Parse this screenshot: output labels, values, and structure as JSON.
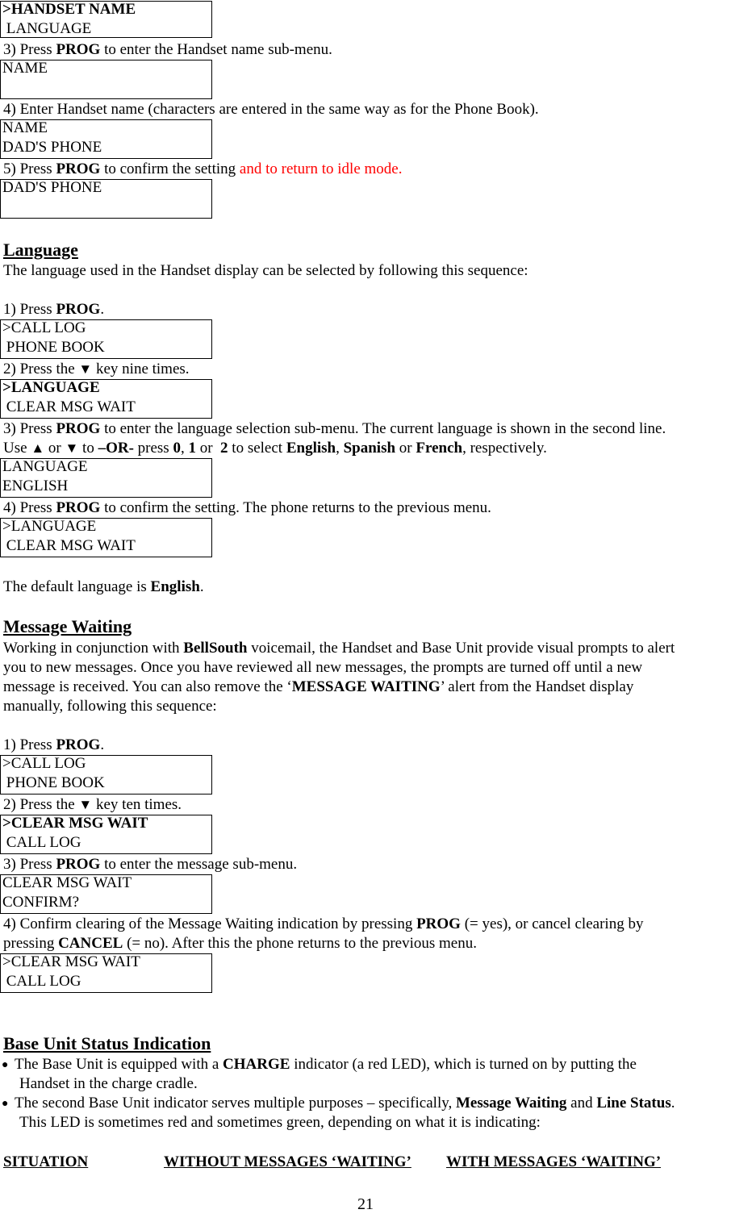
{
  "page_number": "21",
  "colors": {
    "highlight_red": "#ff0000",
    "text": "#000000"
  },
  "handset_name": {
    "lcd1": {
      "line1": ">HANDSET NAME",
      "line2": " LANGUAGE"
    },
    "step3": {
      "pre": "3) Press ",
      "key": "PROG",
      "post": " to enter the Handset name sub-menu."
    },
    "lcd2": {
      "line1": "NAME",
      "line2": ""
    },
    "step4": "4) Enter Handset name (characters are entered in the same way as for the Phone Book).",
    "lcd3": {
      "line1": "NAME",
      "line2": "DAD'S PHONE"
    },
    "step5": {
      "pre": "5) Press ",
      "key": "PROG",
      "mid": " to confirm the setting ",
      "red": "and to return to idle mode."
    },
    "lcd4": {
      "line1": "DAD'S PHONE",
      "line2": ""
    }
  },
  "language": {
    "title": "Language",
    "intro": "The language used in the Handset display can be selected by following this sequence:",
    "step1": {
      "pre": "1) Press ",
      "key": "PROG",
      "post": "."
    },
    "lcd1": {
      "line1": ">CALL LOG",
      "line2": " PHONE BOOK"
    },
    "step2": {
      "pre": "2) Press the ",
      "arrow": "▼",
      "post": " key nine times."
    },
    "lcd2": {
      "line1": ">LANGUAGE",
      "line2": " CLEAR MSG WAIT"
    },
    "step3a": {
      "pre": "3) Press ",
      "key": "PROG",
      "post": " to enter the language selection sub-menu. The current language is shown in the second line."
    },
    "step3b": {
      "t1": "Use ",
      "up": "▲",
      "t2": " or ",
      "down": "▼",
      "t3": " to ",
      "or": "–OR-",
      "t4": " press ",
      "k0": "0",
      "t5": ", ",
      "k1": "1",
      "t6": " or  ",
      "k2": "2",
      "t7": " to select ",
      "en": "English",
      "t8": ", ",
      "es": "Spanish",
      "t9": " or ",
      "fr": "French",
      "t10": ", respectively."
    },
    "lcd3": {
      "line1": "LANGUAGE",
      "line2": "ENGLISH"
    },
    "step4": {
      "pre": "4) Press ",
      "key": "PROG",
      "post": " to confirm the setting. The phone returns to the previous menu."
    },
    "lcd4": {
      "line1": ">LANGUAGE",
      "line2": " CLEAR MSG WAIT"
    },
    "default": {
      "pre": "The default language is ",
      "value": "English",
      "post": "."
    }
  },
  "message_waiting": {
    "title": "Message Waiting",
    "para": {
      "l1pre": "Working in conjunction with ",
      "brand": "BellSouth",
      "l1post": " voicemail, the Handset and Base Unit provide visual prompts to alert",
      "l2": "you to new messages.  Once you have reviewed all new messages, the prompts are turned off until a new",
      "l3pre": "message is received.  You can also remove the ‘",
      "alert": "MESSAGE WAITING",
      "l3post": "’ alert from the Handset display",
      "l4": "manually, following this sequence:"
    },
    "step1": {
      "pre": "1) Press ",
      "key": "PROG",
      "post": "."
    },
    "lcd1": {
      "line1": ">CALL LOG",
      "line2": " PHONE BOOK"
    },
    "step2": {
      "pre": "2) Press the ",
      "arrow": "▼",
      "post": " key ten times."
    },
    "lcd2": {
      "line1": ">CLEAR MSG WAIT",
      "line2": " CALL LOG"
    },
    "step3": {
      "pre": "3) Press ",
      "key": "PROG",
      "post": " to enter the message sub-menu."
    },
    "lcd3": {
      "line1": "CLEAR MSG WAIT",
      "line2": "CONFIRM?"
    },
    "step4": {
      "l1pre": "4) Confirm clearing of the Message Waiting indication by pressing ",
      "key1": "PROG",
      "l1post": " (= yes), or cancel clearing by",
      "l2pre": "pressing ",
      "key2": "CANCEL",
      "l2post": " (= no).  After this the phone returns to the previous menu."
    },
    "lcd4": {
      "line1": ">CLEAR MSG WAIT",
      "line2": " CALL LOG"
    }
  },
  "base_unit": {
    "title": "Base Unit Status Indication",
    "bullet_glyph": "●",
    "bullet1": {
      "pre": "The Base Unit is equipped with a ",
      "key": "CHARGE",
      "post": " indicator (a red LED), which is turned on by putting the",
      "l2": "Handset in the charge cradle."
    },
    "bullet2": {
      "pre": "The second Base Unit indicator serves multiple purposes – specifically, ",
      "b1": "Message Waiting",
      "mid": " and ",
      "b2": "Line Status",
      "post": ".",
      "l2": "This LED is sometimes red and sometimes green, depending on what it is indicating:"
    },
    "table_headers": [
      "SITUATION",
      "WITHOUT MESSAGES ‘WAITING’",
      "WITH MESSAGES ‘WAITING’"
    ]
  }
}
